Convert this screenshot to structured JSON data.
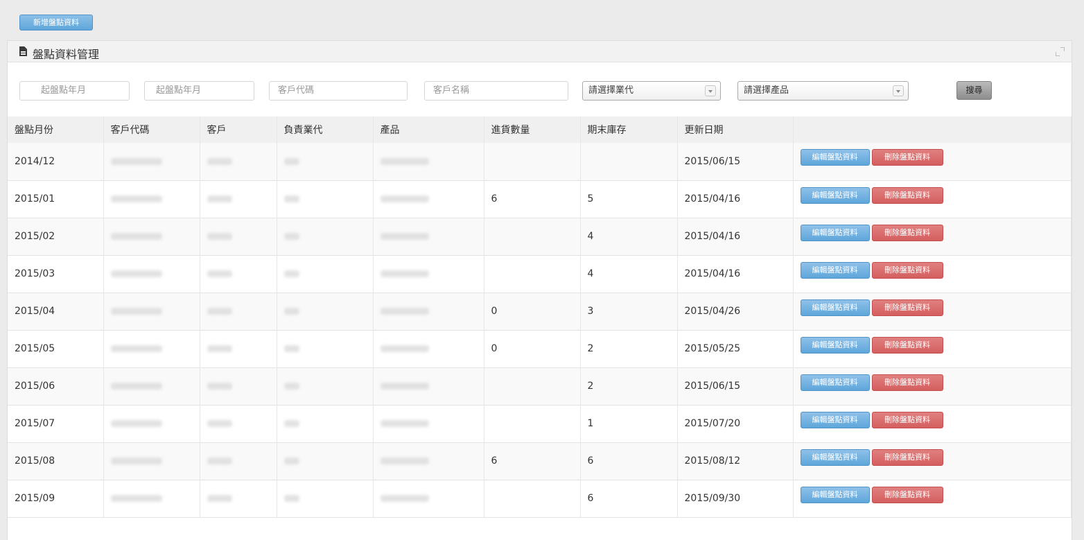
{
  "toolbar": {
    "add_label": "新增盤點資料"
  },
  "panel": {
    "title": "盤點資料管理"
  },
  "filters": {
    "start_month_1": "起盤點年月",
    "start_month_2": "起盤點年月",
    "customer_code": "客戶代碼",
    "customer_name": "客戶名稱",
    "agent_select": "請選擇業代",
    "product_select": "請選擇產品",
    "search_label": "搜尋"
  },
  "table": {
    "headers": [
      "盤點月份",
      "客戶代碼",
      "客戶",
      "負責業代",
      "產品",
      "進貨數量",
      "期末庫存",
      "更新日期",
      ""
    ],
    "edit_label": "編輯盤點資料",
    "delete_label": "刪除盤點資料",
    "rows": [
      {
        "month": "2014/12",
        "incoming": "",
        "ending": "",
        "updated": "2015/06/15"
      },
      {
        "month": "2015/01",
        "incoming": "6",
        "ending": "5",
        "updated": "2015/04/16"
      },
      {
        "month": "2015/02",
        "incoming": "",
        "ending": "4",
        "updated": "2015/04/16"
      },
      {
        "month": "2015/03",
        "incoming": "",
        "ending": "4",
        "updated": "2015/04/16"
      },
      {
        "month": "2015/04",
        "incoming": "0",
        "ending": "3",
        "updated": "2015/04/26"
      },
      {
        "month": "2015/05",
        "incoming": "0",
        "ending": "2",
        "updated": "2015/05/25"
      },
      {
        "month": "2015/06",
        "incoming": "",
        "ending": "2",
        "updated": "2015/06/15"
      },
      {
        "month": "2015/07",
        "incoming": "",
        "ending": "1",
        "updated": "2015/07/20"
      },
      {
        "month": "2015/08",
        "incoming": "6",
        "ending": "6",
        "updated": "2015/08/12"
      },
      {
        "month": "2015/09",
        "incoming": "",
        "ending": "6",
        "updated": "2015/09/30"
      }
    ]
  }
}
